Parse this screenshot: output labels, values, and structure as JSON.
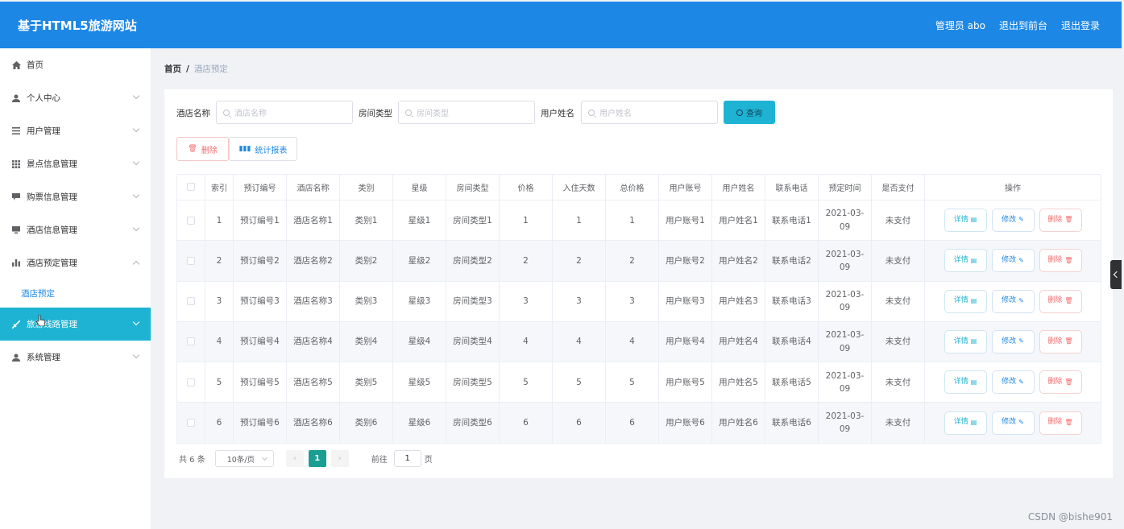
{
  "header": {
    "brand": "基于HTML5旅游网站",
    "user": "管理员 abo",
    "back_front": "退出到前台",
    "logout": "退出登录"
  },
  "sidebar": {
    "items": [
      {
        "label": "首页",
        "icon": "home-icon",
        "expandable": false
      },
      {
        "label": "个人中心",
        "icon": "person-icon",
        "expandable": true
      },
      {
        "label": "用户管理",
        "icon": "list-icon",
        "expandable": true
      },
      {
        "label": "景点信息管理",
        "icon": "grid-icon",
        "expandable": true
      },
      {
        "label": "购票信息管理",
        "icon": "chat-icon",
        "expandable": true
      },
      {
        "label": "酒店信息管理",
        "icon": "monitor-icon",
        "expandable": true
      },
      {
        "label": "酒店预定管理",
        "icon": "bar-chart-icon",
        "expandable": true,
        "expanded": true
      },
      {
        "label": "旅游线路管理",
        "icon": "route-icon",
        "expandable": true,
        "active": true
      },
      {
        "label": "系统管理",
        "icon": "person-icon",
        "expandable": true
      }
    ],
    "submenu_label": "酒店预定"
  },
  "breadcrumb": {
    "home": "首页",
    "separator": "/",
    "current": "酒店预定"
  },
  "search": {
    "hotel_label": "酒店名称",
    "hotel_placeholder": "酒店名称",
    "room_label": "房间类型",
    "room_placeholder": "房间类型",
    "user_label": "用户姓名",
    "user_placeholder": "用户姓名",
    "query_label": "查询"
  },
  "actions": {
    "delete_label": "删除",
    "report_label": "统计报表"
  },
  "table": {
    "headers": [
      "索引",
      "预订编号",
      "酒店名称",
      "类别",
      "星级",
      "房间类型",
      "价格",
      "入住天数",
      "总价格",
      "用户账号",
      "用户姓名",
      "联系电话",
      "预定时间",
      "是否支付",
      "操作"
    ],
    "rows": [
      {
        "idx": "1",
        "no": "预订编号1",
        "hotel": "酒店名称1",
        "cat": "类别1",
        "star": "星级1",
        "room": "房间类型1",
        "price": "1",
        "days": "1",
        "total": "1",
        "acct": "用户账号1",
        "name": "用户姓名1",
        "phone": "联系电话1",
        "date_a": "2021-03-",
        "date_b": "09",
        "paid": "未支付"
      },
      {
        "idx": "2",
        "no": "预订编号2",
        "hotel": "酒店名称2",
        "cat": "类别2",
        "star": "星级2",
        "room": "房间类型2",
        "price": "2",
        "days": "2",
        "total": "2",
        "acct": "用户账号2",
        "name": "用户姓名2",
        "phone": "联系电话2",
        "date_a": "2021-03-",
        "date_b": "09",
        "paid": "未支付"
      },
      {
        "idx": "3",
        "no": "预订编号3",
        "hotel": "酒店名称3",
        "cat": "类别3",
        "star": "星级3",
        "room": "房间类型3",
        "price": "3",
        "days": "3",
        "total": "3",
        "acct": "用户账号3",
        "name": "用户姓名3",
        "phone": "联系电话3",
        "date_a": "2021-03-",
        "date_b": "09",
        "paid": "未支付"
      },
      {
        "idx": "4",
        "no": "预订编号4",
        "hotel": "酒店名称4",
        "cat": "类别4",
        "star": "星级4",
        "room": "房间类型4",
        "price": "4",
        "days": "4",
        "total": "4",
        "acct": "用户账号4",
        "name": "用户姓名4",
        "phone": "联系电话4",
        "date_a": "2021-03-",
        "date_b": "09",
        "paid": "未支付"
      },
      {
        "idx": "5",
        "no": "预订编号5",
        "hotel": "酒店名称5",
        "cat": "类别5",
        "star": "星级5",
        "room": "房间类型5",
        "price": "5",
        "days": "5",
        "total": "5",
        "acct": "用户账号5",
        "name": "用户姓名5",
        "phone": "联系电话5",
        "date_a": "2021-03-",
        "date_b": "09",
        "paid": "未支付"
      },
      {
        "idx": "6",
        "no": "预订编号6",
        "hotel": "酒店名称6",
        "cat": "类别6",
        "star": "星级6",
        "room": "房间类型6",
        "price": "6",
        "days": "6",
        "total": "6",
        "acct": "用户账号6",
        "name": "用户姓名6",
        "phone": "联系电话6",
        "date_a": "2021-03-",
        "date_b": "09",
        "paid": "未支付"
      }
    ],
    "op_detail": "详情",
    "op_edit": "修改",
    "op_delete": "删除"
  },
  "pager": {
    "total": "共 6 条",
    "page_size": "10条/页",
    "current_page": "1",
    "goto_label": "前往",
    "goto_value": "1",
    "page_suffix": "页"
  },
  "watermark": "CSDN @bishe901",
  "colors": {
    "header": "#1d87e5",
    "accent": "#1eb3d3",
    "active_page": "#1a9e91",
    "danger": "#f56c6c"
  }
}
